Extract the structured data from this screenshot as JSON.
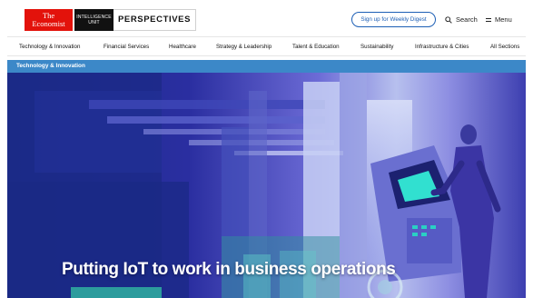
{
  "header": {
    "logo_economist_line1": "The",
    "logo_economist_line2": "Economist",
    "logo_eiu_line1": "INTELLIGENCE",
    "logo_eiu_line2": "UNIT",
    "logo_perspectives": "PERSPECTIVES",
    "signup_label": "Sign up for Weekly Digest",
    "search_label": "Search",
    "menu_label": "Menu"
  },
  "nav": {
    "items": [
      {
        "label": "Technology & Innovation"
      },
      {
        "label": "Financial Services"
      },
      {
        "label": "Healthcare"
      },
      {
        "label": "Strategy & Leadership"
      },
      {
        "label": "Talent & Education"
      },
      {
        "label": "Sustainability"
      },
      {
        "label": "Infrastructure & Cities"
      },
      {
        "label": "All Sections"
      }
    ]
  },
  "section": {
    "label": "Technology & Innovation"
  },
  "hero": {
    "title": "Putting IoT to work in business operations"
  },
  "colors": {
    "brand_red": "#e3120b",
    "link_blue": "#1d5fb5",
    "section_blue": "#3c88c8",
    "hero_deep_blue": "#2a2a9a"
  }
}
